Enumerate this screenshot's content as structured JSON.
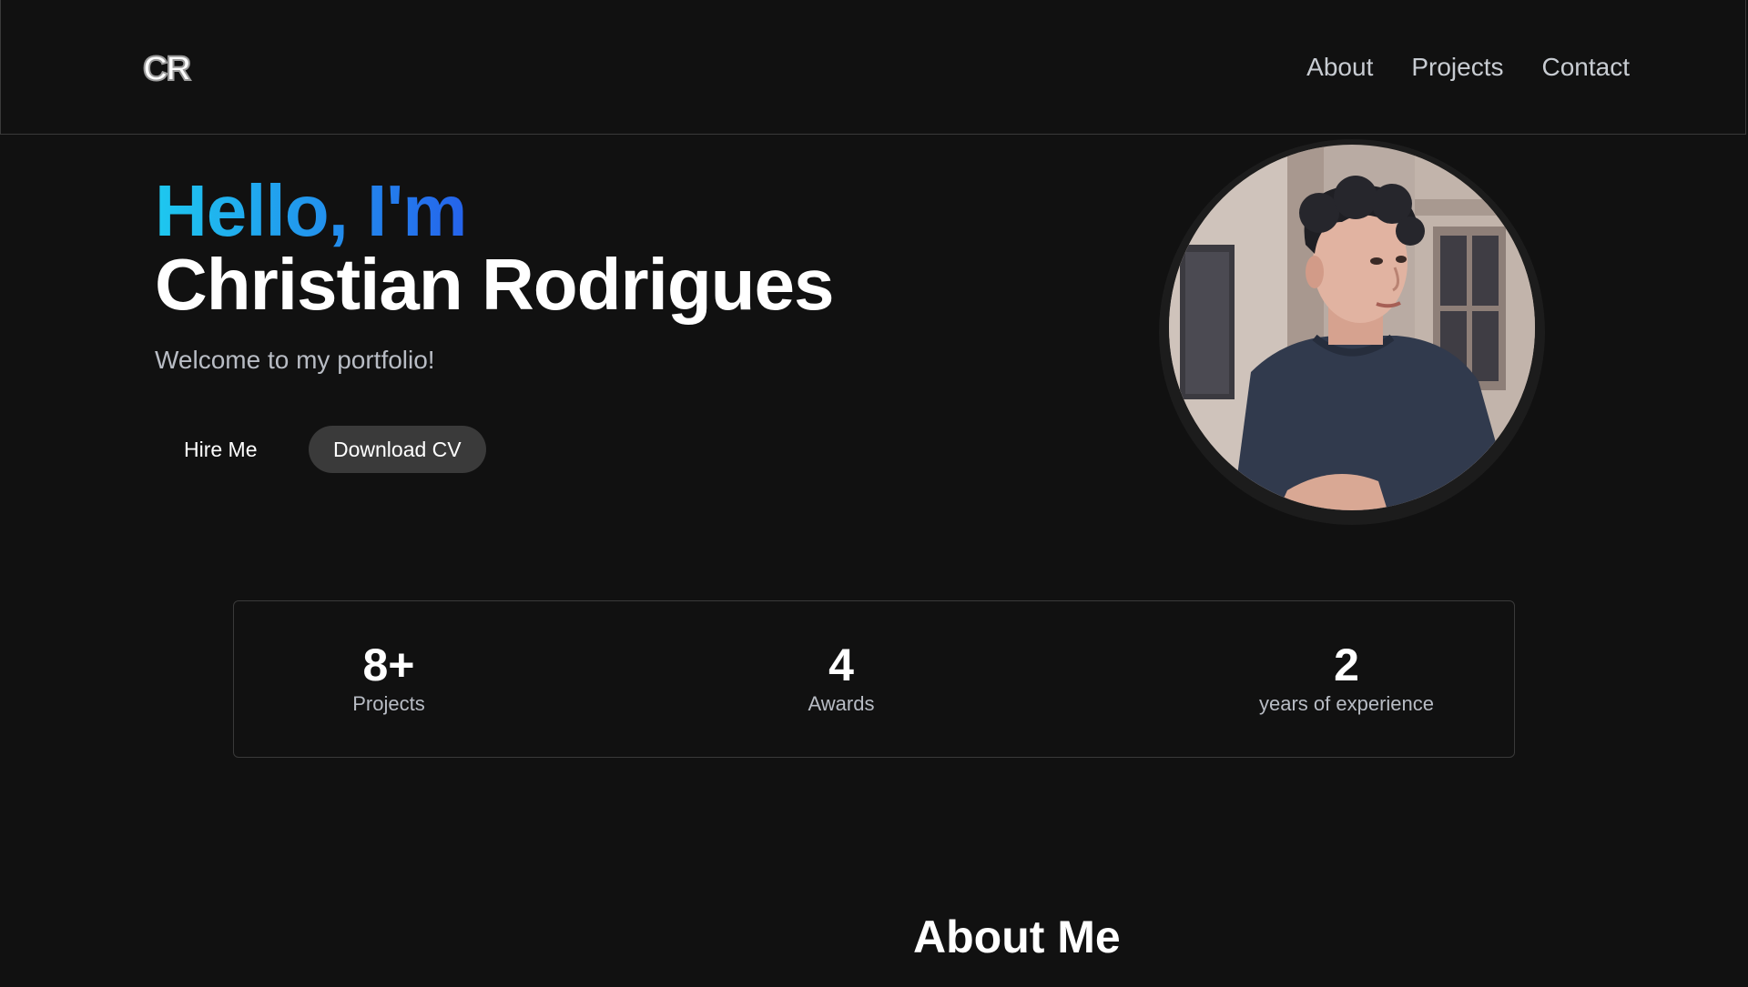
{
  "header": {
    "logo_text": "CR",
    "nav": [
      {
        "label": "About"
      },
      {
        "label": "Projects"
      },
      {
        "label": "Contact"
      }
    ]
  },
  "hero": {
    "greeting": "Hello, I'm",
    "name": "Christian Rodrigues",
    "subtitle": "Welcome to my portfolio!",
    "hire_label": "Hire Me",
    "cv_label": "Download CV",
    "gradient_start": "#1ec8ef",
    "gradient_end": "#2563eb"
  },
  "stats": [
    {
      "value": "8+",
      "label": "Projects"
    },
    {
      "value": "4",
      "label": "Awards"
    },
    {
      "value": "2",
      "label": "years of experience"
    }
  ],
  "about": {
    "title": "About Me"
  }
}
